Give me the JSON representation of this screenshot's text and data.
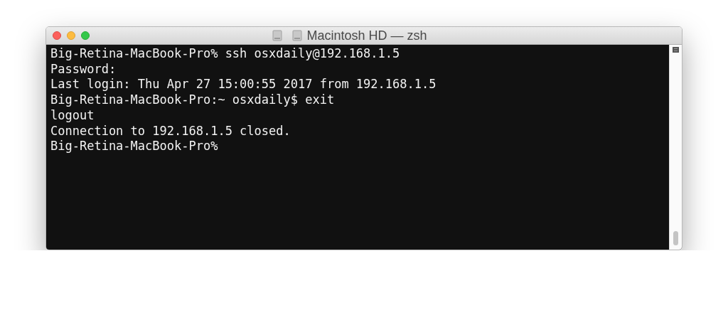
{
  "window": {
    "title": "Macintosh HD — zsh"
  },
  "terminal": {
    "lines": [
      "Big-Retina-MacBook-Pro% ssh osxdaily@192.168.1.5",
      "Password:",
      "Last login: Thu Apr 27 15:00:55 2017 from 192.168.1.5",
      "Big-Retina-MacBook-Pro:~ osxdaily$ exit",
      "logout",
      "Connection to 192.168.1.5 closed.",
      "Big-Retina-MacBook-Pro%"
    ]
  }
}
